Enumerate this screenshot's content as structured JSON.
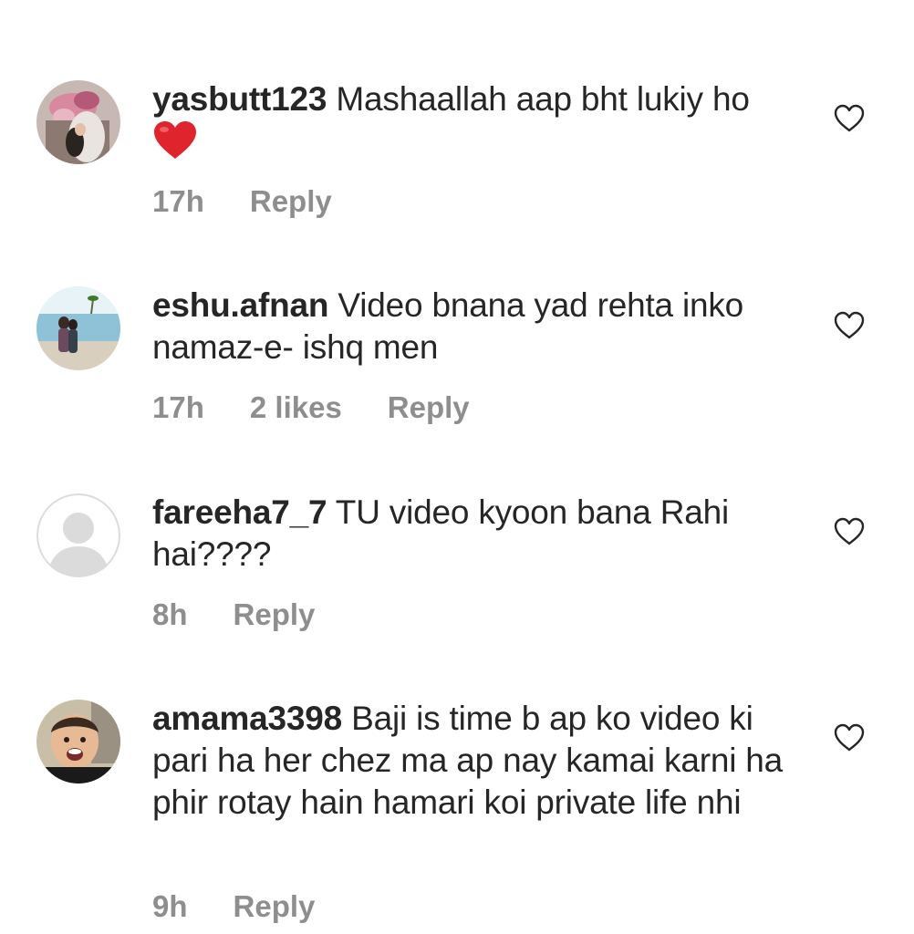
{
  "comments": [
    {
      "username": "yasbutt123",
      "text": "Mashaallah aap bht lukiy ho",
      "emoji": "red-heart",
      "time": "17h",
      "likes": "",
      "reply_label": "Reply"
    },
    {
      "username": "eshu.afnan",
      "text": "Video bnana yad rehta inko namaz-e- ishq men",
      "time": "17h",
      "likes": "2 likes",
      "reply_label": "Reply"
    },
    {
      "username": "fareeha7_7",
      "text": "TU video kyoon bana Rahi hai????",
      "time": "8h",
      "likes": "",
      "reply_label": "Reply"
    },
    {
      "username": "amama3398",
      "text": "Baji is time b ap ko video ki pari ha her chez ma ap nay kamai karni ha phir rotay hain hamari koi private life nhi",
      "time": "9h",
      "likes": "",
      "reply_label": "Reply"
    }
  ],
  "colors": {
    "text": "#262626",
    "secondary": "#8e8e8e",
    "heart_emoji": "#e0242d"
  },
  "icons": {
    "like": "heart-outline-icon",
    "emoji": "red-heart-emoji"
  }
}
